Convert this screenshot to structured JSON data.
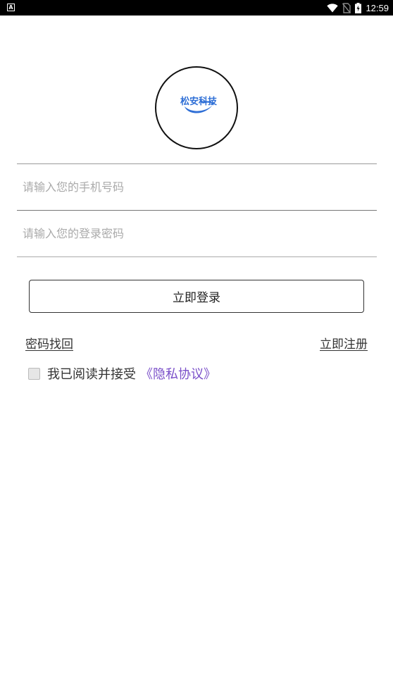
{
  "status_bar": {
    "left_icon_label": "A",
    "time": "12:59"
  },
  "logo": {
    "text": "松安科技",
    "brand_color": "#2f6fd6"
  },
  "form": {
    "phone_placeholder": "请输入您的手机号码",
    "password_placeholder": "请输入您的登录密码",
    "login_label": "立即登录"
  },
  "links": {
    "forgot_password": "密码找回",
    "register": "立即注册"
  },
  "agreement": {
    "text": "我已阅读并接受",
    "privacy_link": "《隐私协议》",
    "privacy_color": "#7a4fc9",
    "checked": false
  }
}
